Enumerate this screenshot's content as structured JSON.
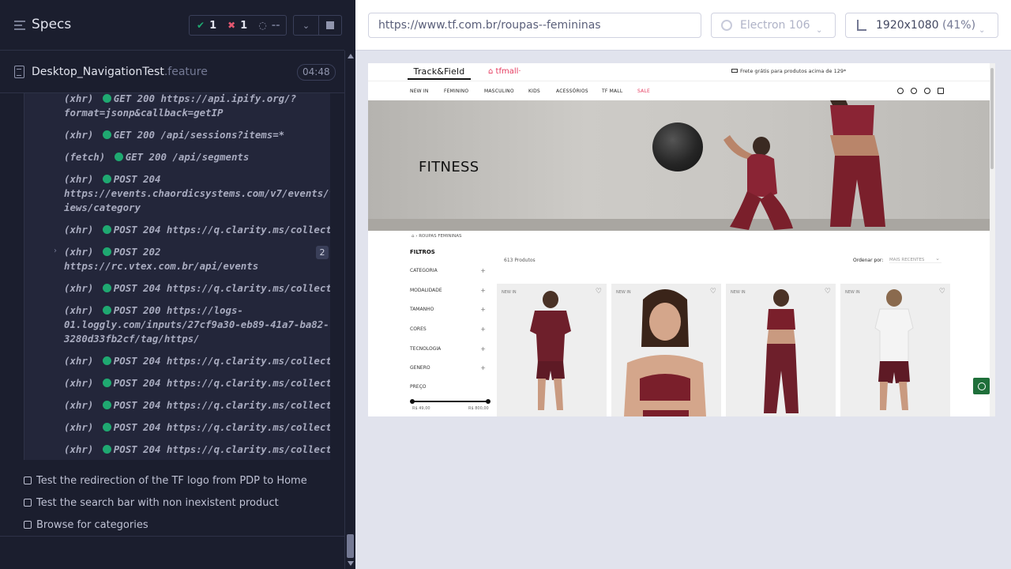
{
  "reporter": {
    "title": "Specs",
    "stats": {
      "passed": "1",
      "failed": "1",
      "pending": "--"
    },
    "spec_file": {
      "name": "Desktop_NavigationTest",
      "ext": ".feature",
      "duration": "04:48"
    },
    "logs": [
      {
        "kind": "(xhr)",
        "line1": "GET 200 https://api.ipify.org/?",
        "line2": "format=jsonp&callback=getIP"
      },
      {
        "kind": "(xhr)",
        "line1": "GET 200 /api/sessions?items=*"
      },
      {
        "kind": "(fetch)",
        "line1": "GET 200 /api/segments"
      },
      {
        "kind": "(xhr)",
        "line1": "POST 204",
        "line2": "https://events.chaordicsystems.com/v7/events/v",
        "line3": "iews/category"
      },
      {
        "kind": "(xhr)",
        "line1": "POST 204 https://q.clarity.ms/collect"
      },
      {
        "kind": "(xhr)",
        "line1": "POST 202",
        "line2": "https://rc.vtex.com.br/api/events",
        "badge": "2"
      },
      {
        "kind": "(xhr)",
        "line1": "POST 204 https://q.clarity.ms/collect"
      },
      {
        "kind": "(xhr)",
        "line1": "POST 200 https://logs-",
        "line2": "01.loggly.com/inputs/27cf9a30-eb89-41a7-ba82-",
        "line3": "3280d33fb2cf/tag/https/"
      },
      {
        "kind": "(xhr)",
        "line1": "POST 204 https://q.clarity.ms/collect"
      },
      {
        "kind": "(xhr)",
        "line1": "POST 204 https://q.clarity.ms/collect"
      },
      {
        "kind": "(xhr)",
        "line1": "POST 204 https://q.clarity.ms/collect"
      },
      {
        "kind": "(xhr)",
        "line1": "POST 204 https://q.clarity.ms/collect"
      },
      {
        "kind": "(xhr)",
        "line1": "POST 204 https://q.clarity.ms/collect"
      }
    ],
    "tests": [
      "Test the redirection of the TF logo from PDP to Home",
      "Test the search bar with non inexistent product",
      "Browse for categories"
    ]
  },
  "aut": {
    "url": "https://www.tf.com.br/roupas--femininas",
    "browser": "Electron 106",
    "viewport": "1920x1080",
    "scale": "(41%)"
  },
  "site": {
    "logo": "Track&Field",
    "mall_logo": "tfmall·",
    "shipping_banner": "Frete grátis para produtos acima de 129*",
    "nav": [
      "NEW IN",
      "FEMININO",
      "MASCULINO",
      "KIDS",
      "ACESSÓRIOS",
      "TF MALL",
      "SALE"
    ],
    "hero_title": "FITNESS",
    "breadcrumb": "ROUPAS FEMININAS",
    "filters_title": "FILTROS",
    "filters": [
      "CATEGORIA",
      "MODALIDADE",
      "TAMANHO",
      "CORES",
      "TECNOLOGIA",
      "GENERO"
    ],
    "price_label": "PREÇO",
    "price_min": "R$ 49,00",
    "price_max": "R$ 800,00",
    "product_count": "613 Produtos",
    "order_label": "Ordenar por:",
    "order_value": "MAIS RECENTES",
    "products": [
      {
        "tag": "NEW IN"
      },
      {
        "tag": "NEW IN"
      },
      {
        "tag": "NEW IN"
      },
      {
        "tag": "NEW IN"
      }
    ],
    "colors": {
      "accent": "#e53b5f",
      "product_wine": "#7a1f2b"
    }
  }
}
